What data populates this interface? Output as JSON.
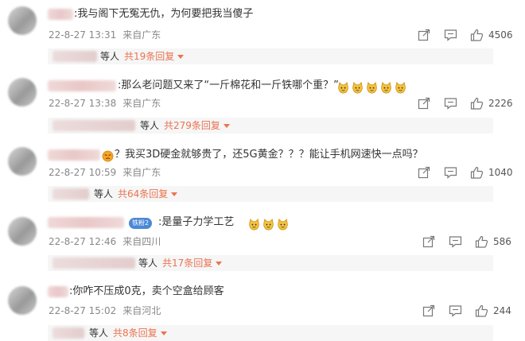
{
  "icons": {
    "share": "share-icon",
    "comment": "comment-icon",
    "like": "thumbs-up-icon",
    "emoji": "doge-cat-emoji-icon"
  },
  "colors": {
    "link": "#eb7350",
    "meta": "#888888",
    "text": "#333333",
    "reply_bg": "#f6f6f6"
  },
  "comments": [
    {
      "text": ":我与阁下无冤无仇，为何要把我当傻子",
      "time": "22-8-27 13:31",
      "location": "来自广东",
      "likes": "4506",
      "reply_etc": "等人",
      "reply_link": "共19条回复",
      "emoji_count": 0
    },
    {
      "text": ":那么老问题又来了“一斤棉花和一斤铁哪个重？”",
      "time": "22-8-27 13:38",
      "location": "来自广东",
      "likes": "2226",
      "reply_etc": "等人",
      "reply_link": "共279条回复",
      "emoji_count": 5
    },
    {
      "text": "？我买3D硬金就够贵了，还5G黄金？？？能让手机网速快一点吗？",
      "time": "22-8-27 10:59",
      "location": "来自广东",
      "likes": "1040",
      "reply_etc": "等人",
      "reply_link": "共64条回复",
      "emoji_count": 0
    },
    {
      "badge": "铁粉2",
      "text": ":是量子力学工艺",
      "time": "22-8-27 12:46",
      "location": "来自四川",
      "likes": "586",
      "reply_etc": "等人",
      "reply_link": "共17条回复",
      "emoji_count": 3
    },
    {
      "text": ":你咋不压成0克，卖个空盒给顾客",
      "time": "22-8-27 15:02",
      "location": "来自河北",
      "likes": "244",
      "reply_etc": "等人",
      "reply_link": "共8条回复",
      "emoji_count": 0
    }
  ]
}
